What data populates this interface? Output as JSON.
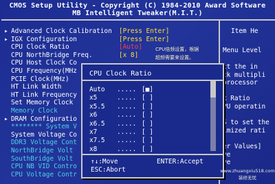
{
  "header": {
    "line1": "CMOS Setup Utility - Copyright (C) 1984-2010 Award Software",
    "line2": "MB Intelligent Tweaker(M.I.T.)"
  },
  "menu": [
    {
      "arrow": "▸",
      "label": "Advanced Clock Calibration",
      "value": "[Press Enter]",
      "color": "white"
    },
    {
      "arrow": "▸",
      "label": "IGX Configuration",
      "value": "[Press Enter]",
      "color": "white"
    },
    {
      "arrow": "",
      "label": "CPU Clock Ratio",
      "value": "[Auto]",
      "color": "white",
      "highlight": true
    },
    {
      "arrow": "",
      "label": "CPU NorthBridge Freq.",
      "value": "[x 8]",
      "color": "white"
    },
    {
      "arrow": "",
      "label": "CPU Host Clock Co",
      "value": "",
      "color": "white"
    },
    {
      "arrow": "",
      "label": "CPU Frequency(MHz",
      "value": "",
      "color": "white"
    },
    {
      "arrow": "",
      "label": "PCIE Clock(MHz)",
      "value": "",
      "color": "white"
    },
    {
      "arrow": "",
      "label": "HT Link Width",
      "value": "",
      "color": "white"
    },
    {
      "arrow": "",
      "label": "HT Link Frequency",
      "value": "",
      "color": "white"
    },
    {
      "arrow": "",
      "label": "Set Memory Clock",
      "value": "",
      "color": "white"
    },
    {
      "arrow": "",
      "label": "Memory Clock",
      "value": "",
      "color": "cyan"
    },
    {
      "arrow": "▸",
      "label": "DRAM Configuratio",
      "value": "",
      "color": "white"
    },
    {
      "arrow": "",
      "label": "******** System V",
      "value": "",
      "color": "cyan"
    },
    {
      "arrow": "",
      "label": "System Voltage Co",
      "value": "",
      "color": "white"
    },
    {
      "arrow": "",
      "label": "DDR3 Voltage Cont",
      "value": "",
      "color": "cyan"
    },
    {
      "arrow": "",
      "label": "NorthBridge Volt",
      "value": "",
      "color": "cyan"
    },
    {
      "arrow": "",
      "label": "SouthBridge Volt",
      "value": "",
      "color": "cyan"
    },
    {
      "arrow": "",
      "label": "CPU NB VID Contro",
      "value": "",
      "color": "cyan"
    },
    {
      "arrow": "",
      "label": "CPU Voltage Contr",
      "value": "",
      "color": "cyan"
    }
  ],
  "note": {
    "line1": "CPU倍频设置，根据",
    "line2": "超频需要来设置。"
  },
  "help": {
    "title": "Item He",
    "menu_level": "Menu Level",
    "lines": [
      "ct the in",
      "ck multipli",
      "processor",
      "",
      "x Ratio",
      "PU operatin",
      "",
      "S to set the",
      "imized rati",
      "",
      "er Values]",
      "ve",
      "ve"
    ]
  },
  "popup": {
    "title": "CPU Clock Ratio",
    "options": [
      {
        "label": "Auto",
        "dots": ".....",
        "box": "[■]"
      },
      {
        "label": "x5",
        "dots": ".....",
        "box": "[ ]"
      },
      {
        "label": "x5.5",
        "dots": ".....",
        "box": "[ ]"
      },
      {
        "label": "x6",
        "dots": ".....",
        "box": "[ ]"
      },
      {
        "label": "x6.5",
        "dots": ".....",
        "box": "[ ]"
      },
      {
        "label": "x7",
        "dots": ".....",
        "box": "[ ]"
      },
      {
        "label": "x7.5",
        "dots": ".....",
        "box": "[ ]"
      },
      {
        "label": "x8",
        "dots": ".....",
        "box": "[ ]"
      }
    ],
    "keys": {
      "move": "↑↓:Move",
      "accept": "ENTER:Accept",
      "abort": "ESC:Abort"
    }
  },
  "watermark": {
    "line1": "www.zhuangxiu518.com",
    "line2": "装修无忧"
  },
  "colors": {
    "background": "#1c2c92",
    "text": "#ffffff",
    "value": "#ffe030",
    "highlight": "#ff4040",
    "disabled": "#50d0e8"
  }
}
